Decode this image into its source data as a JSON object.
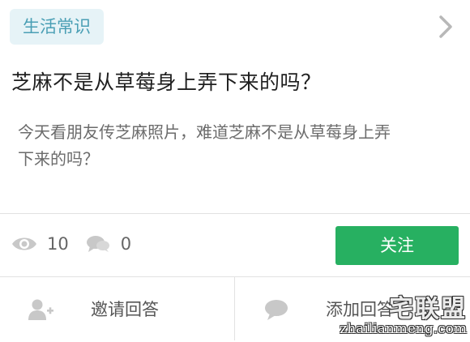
{
  "category_tag": "生活常识",
  "question": {
    "title": "芝麻不是从草莓身上弄下来的吗？",
    "description_line1": "今天看朋友传芝麻照片，难道芝麻不是从草莓身上弄",
    "description_line2": "下来的吗？"
  },
  "stats": {
    "views": "10",
    "comments": "0"
  },
  "follow_button": "关注",
  "bottom_actions": {
    "invite": "邀请回答",
    "add": "添加回答"
  },
  "watermark": {
    "top": "宅联盟",
    "bottom": "zhailianmeng.com"
  },
  "colors": {
    "tag_bg": "#e6f3f7",
    "tag_text": "#4a9fb5",
    "follow_bg": "#27b061",
    "icon_gray": "#c8c8c8"
  },
  "icons": {
    "nav": "chevron-right-icon",
    "views": "eye-icon",
    "comments": "chat-bubbles-icon",
    "invite": "add-user-icon",
    "add": "comment-icon"
  }
}
